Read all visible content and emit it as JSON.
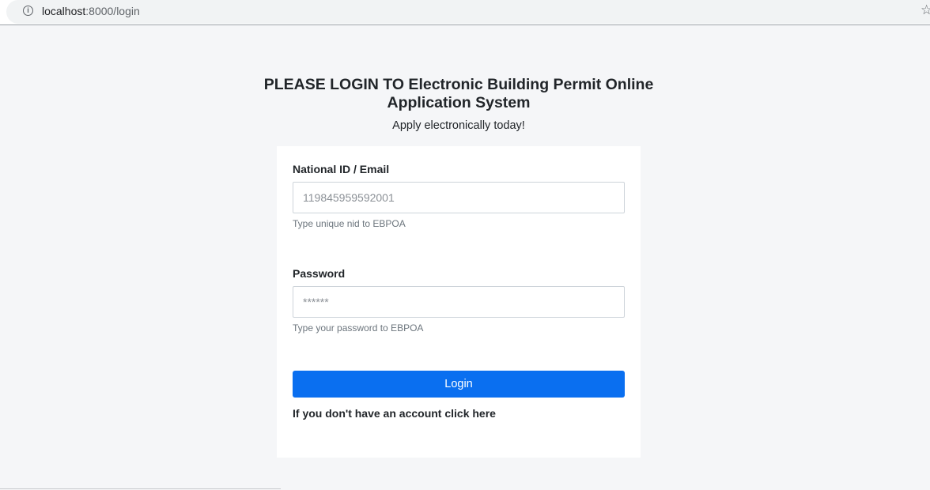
{
  "browser": {
    "url_host": "localhost",
    "url_rest": ":8000/login",
    "info_icon": "info-icon",
    "star_icon": "star-icon"
  },
  "header": {
    "title": "PLEASE LOGIN TO Electronic Building Permit Online Application System",
    "subtitle": "Apply electronically today!"
  },
  "form": {
    "nid": {
      "label": "National ID / Email",
      "placeholder": "119845959592001",
      "value": "",
      "help": "Type unique nid to EBPOA"
    },
    "password": {
      "label": "Password",
      "placeholder": "******",
      "value": "",
      "help": "Type your password to EBPOA"
    },
    "login_label": "Login",
    "register_link": "If you don't have an account click here"
  },
  "colors": {
    "primary": "#0a6ff0",
    "page_background": "#f5f6f8",
    "card_background": "#ffffff"
  }
}
